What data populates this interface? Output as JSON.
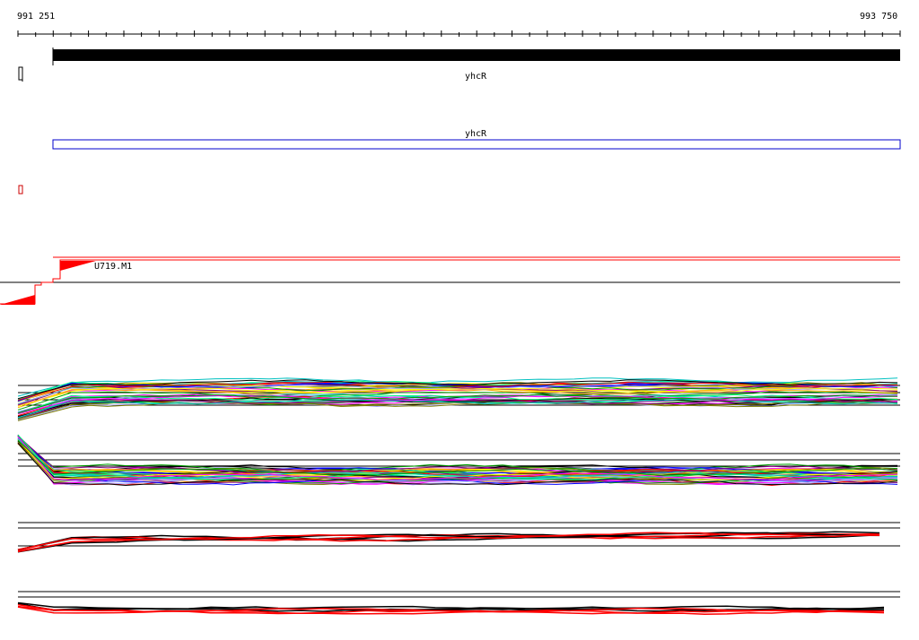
{
  "ruler": {
    "start_label": "991 251",
    "end_label": "993 750"
  },
  "genes": {
    "annotation_label": "yhcR",
    "transcript_label": "yhcR"
  },
  "motif": {
    "label": "U719.M1"
  },
  "colors": {
    "gene_bar": "#000000",
    "transcript_box": "#0000cc",
    "motif": "#ff0000",
    "profile_lines": [
      "#00c0c0",
      "#000000",
      "#ff00ff",
      "#00a000",
      "#ffa500",
      "#0000ff",
      "#ff0000",
      "#a0a0ff",
      "#808000",
      "#ffff00",
      "#800080",
      "#00ff80"
    ]
  },
  "icons": {
    "strand_marker_black": "bracket-icon",
    "strand_marker_red": "bracket-icon"
  }
}
